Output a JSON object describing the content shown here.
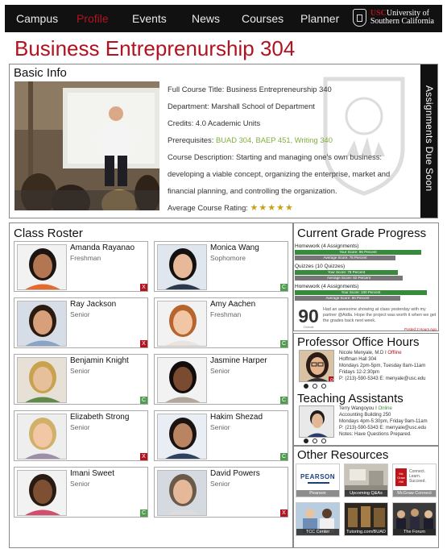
{
  "nav": {
    "items": [
      "Campus",
      "Profile",
      "Events",
      "News",
      "Courses",
      "Planner"
    ],
    "active": "Profile",
    "logo_line1": "USC",
    "logo_line1b": "University of",
    "logo_line2": "Southern California"
  },
  "page": {
    "title": "Business Entreprenurship 304"
  },
  "basic_info": {
    "heading": "Basic Info",
    "full_title_label": "Full Course Title:",
    "full_title": "Business Entrepreneurship 340",
    "department_label": "Department:",
    "department": "Marshall School of Department",
    "credits_label": "Credits:",
    "credits": "4.0 Academic Units",
    "prereq_label": "Prerequisites:",
    "prereqs": "BUAD 304, BAEP 451, Writing 340",
    "desc_label": "Course Description:",
    "desc_1": "Starting and managing one's own business:",
    "desc_2": "developing a viable concept, organizing the enterprise, market and",
    "desc_3": "financial planning, and controlling the organization.",
    "rating_label": "Average Course Rating:",
    "rating_stars": "★★★★★",
    "assignments_tab": "Assignments Due Soon"
  },
  "roster": {
    "heading": "Class Roster",
    "students": [
      {
        "name": "Amanda Rayanao",
        "level": "Freshman",
        "status": "X"
      },
      {
        "name": "Monica Wang",
        "level": "Sophomore",
        "status": "C"
      },
      {
        "name": "Ray Jackson",
        "level": "Senior",
        "status": "X"
      },
      {
        "name": "Amy  Aachen",
        "level": "Freshman",
        "status": "C"
      },
      {
        "name": "Benjamin Knight",
        "level": "Senior",
        "status": "C"
      },
      {
        "name": "Jasmine Harper",
        "level": "Senior",
        "status": "C"
      },
      {
        "name": "Elizabeth Strong",
        "level": "Senior",
        "status": "X"
      },
      {
        "name": "Hakim Shezad",
        "level": "Senior",
        "status": "C"
      },
      {
        "name": "Imani Sweet",
        "level": "Senior",
        "status": "C"
      },
      {
        "name": "David Powers",
        "level": "Senior",
        "status": "X"
      }
    ]
  },
  "grades": {
    "heading": "Current Grade Progress",
    "blocks": [
      {
        "label": "Homework (4 Assignments)",
        "score_text": "Your Score: 96 Percent",
        "score": 96,
        "avg_text": "Average Score: 76 Percent",
        "avg": 76
      },
      {
        "label": "Quizzes (10 Quizzes)",
        "score_text": "Your Score: 78 Percent",
        "score": 78,
        "avg_text": "Average Score: 82 Percent",
        "avg": 82
      },
      {
        "label": "Homework (4 Assignments)",
        "score_text": "Your Score: 100 Percent",
        "score": 100,
        "avg_text": "Average Score: 80 Percent",
        "avg": 80
      }
    ],
    "overall": "90",
    "overall_sub": "Overall",
    "comment": "Had an awesome showing at class yesterday with my partner @Aidla. Hope the project was worth it when we get the grades back next week.",
    "comment_foot": "Posted 2 Hours Ago"
  },
  "office_hours": {
    "heading": "Professor Office Hours",
    "name": "Nicole Menyale, M.D I",
    "status": "Offline",
    "lines": [
      "Hoffman Hall 304",
      "Mondays 2pm-5pm, Tuesday 8am-11am",
      "Fridays 12-2:30pm",
      "P: (213)-590-5343 E: menyale@usc.edu"
    ],
    "badge": "P"
  },
  "assistants": {
    "heading": "Teaching Assistants",
    "name": "Terry Wangoyou I",
    "status": "Online",
    "lines": [
      "Accounting Building 250",
      "Mondays 4pm-5:30pm, Friday 9am-11am",
      "P: (213)-590-5343 E: merryale@usc.edu",
      "Notes: Have Questions Prepared."
    ]
  },
  "resources": {
    "heading": "Other Resources",
    "tiles": [
      "Pearson",
      "Upcoming Q&As",
      "McGraw Connect",
      "TCC Center",
      "Tutoring.com/BUAD",
      "The Forum"
    ],
    "pearson_logo": "PEARSON",
    "connect_logo": "Connect. Learn. Succeed.",
    "mcgraw_logo": "Mc Graw Hill"
  },
  "colors": {
    "accent": "#b3121f",
    "online": "#3a8a3e",
    "bar": "#111111"
  }
}
